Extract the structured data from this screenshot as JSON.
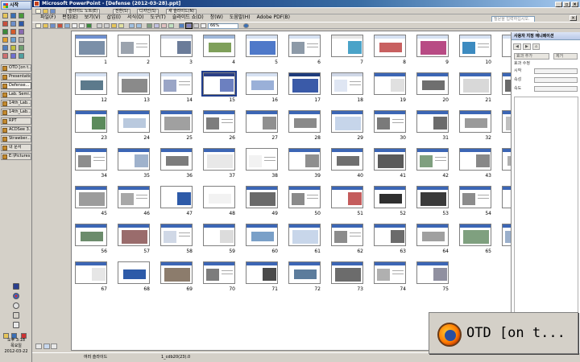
{
  "start": {
    "label": "시작"
  },
  "taskbar": {
    "buttons": [
      {
        "label": "OTD [on t...",
        "icon": "firefox-icon"
      },
      {
        "label": "Presentation",
        "icon": "folder-icon"
      },
      {
        "label": "Defense...",
        "icon": "powerpoint-icon",
        "active": true
      },
      {
        "label": "Lab. Semi...",
        "icon": "folder-icon"
      },
      {
        "label": "14th_Lab...",
        "icon": "folder-icon"
      },
      {
        "label": "14th_Lab...",
        "icon": "folder-icon"
      },
      {
        "label": "RPT",
        "icon": "folder-icon"
      },
      {
        "label": "ACDSee 3...",
        "icon": "acdsee-icon"
      },
      {
        "label": "Strawber...",
        "icon": "folder-icon"
      },
      {
        "label": "내 문서",
        "icon": "folder-icon"
      },
      {
        "label": "E:\\Pictures",
        "icon": "folder-icon"
      }
    ],
    "clock": {
      "time": "오후 3:18",
      "day": "목요일",
      "date": "2012-03-22"
    }
  },
  "window": {
    "title": "Microsoft PowerPoint - [Defense (2012-03-28).ppt]",
    "menu": [
      "파일(F)",
      "편집(E)",
      "보기(V)",
      "삽입(I)",
      "서식(O)",
      "도구(T)",
      "슬라이드 쇼(D)",
      "창(W)",
      "도움말(H)",
      "Adobe PDF(B)"
    ],
    "help_placeholder": "질문을 입력하십시오.",
    "toolbar": {
      "new_slide": "새 슬라이드(N)",
      "show": "전환(S)",
      "design": "디자인(S)",
      "zoom": "66%",
      "notes": "슬라이드 노트(E)"
    }
  },
  "slides": [
    {
      "n": "1",
      "bar": "#6e8fcf",
      "img": "#7b8fa8"
    },
    {
      "n": "2",
      "bar": "#ffffff",
      "img": "#9ba3ae"
    },
    {
      "n": "3",
      "bar": "#cfd7e6",
      "img": "#6b7c99"
    },
    {
      "n": "4",
      "bar": "#9fb7d9",
      "img": "#7fa05a"
    },
    {
      "n": "5",
      "bar": "#d6e1f2",
      "img": "#4f79c9"
    },
    {
      "n": "6",
      "bar": "#d6e1f2",
      "img": "#8d9aa8"
    },
    {
      "n": "7",
      "bar": "#e6e6e6",
      "img": "#4aa3c8"
    },
    {
      "n": "8",
      "bar": "#d6e1f2",
      "img": "#c86060"
    },
    {
      "n": "9",
      "bar": "#d6e1f2",
      "img": "#b84b84"
    },
    {
      "n": "10",
      "bar": "#d6e1f2",
      "img": "#3d8bc0"
    },
    {
      "n": "11",
      "bar": "#d6e1f2",
      "img": "#8c8c8c"
    },
    {
      "n": "12",
      "bar": "#d6e1f2",
      "img": "#5c7a8c"
    },
    {
      "n": "13",
      "bar": "#d6e1f2",
      "img": "#8a8a8a"
    },
    {
      "n": "14",
      "bar": "#d6e1f2",
      "img": "#9aa5c6"
    },
    {
      "n": "15",
      "bar": "#2b3f86",
      "img": "#6c80c0",
      "sel": true
    },
    {
      "n": "16",
      "bar": "#d6e1f2",
      "img": "#9ab0d8"
    },
    {
      "n": "17",
      "bar": "#1e3c7c",
      "img": "#3a5aa8"
    },
    {
      "n": "18",
      "bar": "#cfd7e6",
      "img": "#dfe6f3"
    },
    {
      "n": "19",
      "bar": "#3c66b5",
      "img": "#e0e0e0"
    },
    {
      "n": "20",
      "bar": "#3c66b5",
      "img": "#6f6f6f"
    },
    {
      "n": "21",
      "bar": "#3c66b5",
      "img": "#d8d8d8"
    },
    {
      "n": "22",
      "bar": "#3c66b5",
      "img": "#6a6a6a"
    },
    {
      "n": "23",
      "bar": "#3c66b5",
      "img": "#5c8b5c"
    },
    {
      "n": "24",
      "bar": "#3c66b5",
      "img": "#b9c9de"
    },
    {
      "n": "25",
      "bar": "#3c66b5",
      "img": "#a0a0a0"
    },
    {
      "n": "26",
      "bar": "#3c66b5",
      "img": "#7d7d7d"
    },
    {
      "n": "27",
      "bar": "#3c66b5",
      "img": "#909090"
    },
    {
      "n": "28",
      "bar": "#3c66b5",
      "img": "#8a8a8a"
    },
    {
      "n": "29",
      "bar": "#3c66b5",
      "img": "#c6d5ea"
    },
    {
      "n": "30",
      "bar": "#3c66b5",
      "img": "#7a7a7a"
    },
    {
      "n": "31",
      "bar": "#3c66b5",
      "img": "#6b6b6b"
    },
    {
      "n": "32",
      "bar": "#3c66b5",
      "img": "#9a9a9a"
    },
    {
      "n": "33",
      "bar": "#3c66b5",
      "img": "#c0c0c0"
    },
    {
      "n": "34",
      "bar": "#3c66b5",
      "img": "#8d8d8d"
    },
    {
      "n": "35",
      "bar": "#3c66b5",
      "img": "#9fb2cc"
    },
    {
      "n": "36",
      "bar": "#3c66b5",
      "img": "#7c7c7c"
    },
    {
      "n": "37",
      "bar": "#3c66b5",
      "img": "#e8e8e8"
    },
    {
      "n": "38",
      "bar": "#ffffff",
      "img": "#f2f2f2"
    },
    {
      "n": "39",
      "bar": "#3c66b5",
      "img": "#8f8f8f"
    },
    {
      "n": "40",
      "bar": "#3c66b5",
      "img": "#6f6f6f"
    },
    {
      "n": "41",
      "bar": "#3c66b5",
      "img": "#5a5a5a"
    },
    {
      "n": "42",
      "bar": "#3c66b5",
      "img": "#7f9f7f"
    },
    {
      "n": "43",
      "bar": "#3c66b5",
      "img": "#888888"
    },
    {
      "n": "44",
      "bar": "#3c66b5",
      "img": "#b0b0b0"
    },
    {
      "n": "45",
      "bar": "#3c66b5",
      "img": "#9c9c9c"
    },
    {
      "n": "46",
      "bar": "#3c66b5",
      "img": "#a8a8a8"
    },
    {
      "n": "47",
      "bar": "#ffffff",
      "img": "#2d5aa8"
    },
    {
      "n": "48",
      "bar": "#ffffff",
      "img": "#f2f2f2"
    },
    {
      "n": "49",
      "bar": "#3c66b5",
      "img": "#6a6a6a"
    },
    {
      "n": "50",
      "bar": "#3c66b5",
      "img": "#8a8a8a"
    },
    {
      "n": "51",
      "bar": "#3c66b5",
      "img": "#c45c5c"
    },
    {
      "n": "52",
      "bar": "#3c66b5",
      "img": "#2f2f2f"
    },
    {
      "n": "53",
      "bar": "#3c66b5",
      "img": "#3a3a3a"
    },
    {
      "n": "54",
      "bar": "#3c66b5",
      "img": "#8c8c8c"
    },
    {
      "n": "55",
      "bar": "#3c66b5",
      "img": "#7a7a7a"
    },
    {
      "n": "56",
      "bar": "#3c66b5",
      "img": "#6c8c6c"
    },
    {
      "n": "57",
      "bar": "#3c66b5",
      "img": "#9a6c6c"
    },
    {
      "n": "58",
      "bar": "#3c66b5",
      "img": "#d0d8e6"
    },
    {
      "n": "59",
      "bar": "#3c66b5",
      "img": "#dcdcdc"
    },
    {
      "n": "60",
      "bar": "#3c66b5",
      "img": "#7aa0c8"
    },
    {
      "n": "61",
      "bar": "#3c66b5",
      "img": "#c8d6ea"
    },
    {
      "n": "62",
      "bar": "#3c66b5",
      "img": "#8c8c8c"
    },
    {
      "n": "63",
      "bar": "#3c66b5",
      "img": "#6b6b6b"
    },
    {
      "n": "64",
      "bar": "#3c66b5",
      "img": "#a0a0a0"
    },
    {
      "n": "65",
      "bar": "#3c66b5",
      "img": "#7fa07f"
    },
    {
      "n": "66",
      "bar": "#3c66b5",
      "img": "#9bb0cc"
    },
    {
      "n": "67",
      "bar": "#3c66b5",
      "img": "#e6e6e6"
    },
    {
      "n": "68",
      "bar": "#ffffff",
      "img": "#2d5aa8"
    },
    {
      "n": "69",
      "bar": "#3c66b5",
      "img": "#8c7c6c"
    },
    {
      "n": "70",
      "bar": "#3c66b5",
      "img": "#7c7c7c"
    },
    {
      "n": "71",
      "bar": "#3c66b5",
      "img": "#4a4a4a"
    },
    {
      "n": "72",
      "bar": "#3c66b5",
      "img": "#5c7c9c"
    },
    {
      "n": "73",
      "bar": "#3c66b5",
      "img": "#6c6c6c"
    },
    {
      "n": "74",
      "bar": "#3c66b5",
      "img": "#b0b0b0"
    },
    {
      "n": "75",
      "bar": "#3c66b5",
      "img": "#9090a0"
    }
  ],
  "taskpane": {
    "title": "사용자 지정 애니메이션",
    "add_effect": "효과 추가",
    "remove": "제거",
    "section": "효과 수정",
    "start_label": "시작",
    "property_label": "속성",
    "speed_label": "속도"
  },
  "status": {
    "view": "여러 슬라이드",
    "design": "1_cdb20(23).0"
  },
  "popup": {
    "label": "OTD [on t..."
  }
}
